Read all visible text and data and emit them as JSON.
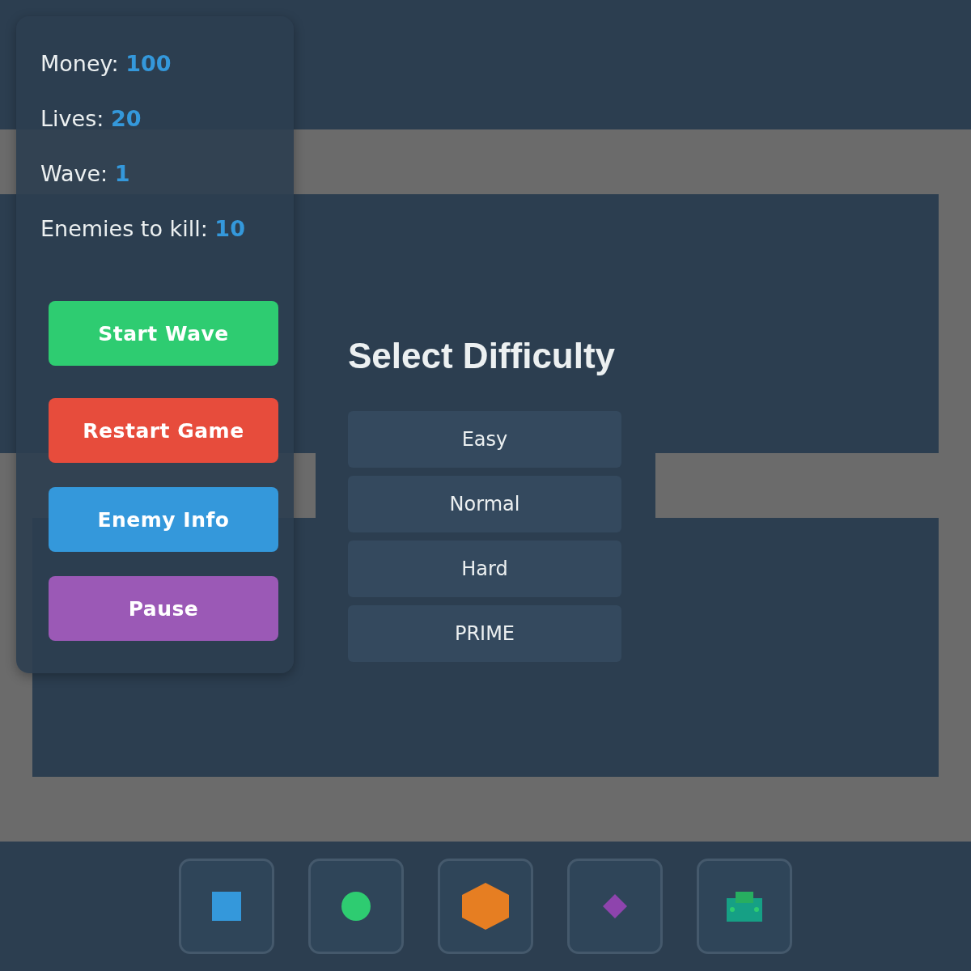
{
  "stats": [
    "Money: **100**",
    "Lives: **20**",
    "Wave: **1**",
    "Enemies to kill: **10**"
  ],
  "controls": [
    {
      "label": "Start Wave",
      "color": "#2ecc71"
    },
    {
      "label": "Restart Game",
      "color": "#e74c3c"
    },
    {
      "label": "Enemy Info",
      "color": "#3498db"
    },
    {
      "label": "Pause",
      "color": "#9b59b6"
    }
  ],
  "dialog": {
    "title": "Select Difficulty",
    "options": [
      "Easy",
      "Normal",
      "Hard",
      "PRIME"
    ]
  },
  "towers": [
    {
      "kind": "square",
      "color": "#3498db"
    },
    {
      "kind": "circle",
      "color": "#2ecc71"
    },
    {
      "kind": "hexagon",
      "color": "#e67e22"
    },
    {
      "kind": "diamond",
      "color": "#8e44ad"
    },
    {
      "kind": "tank",
      "color": "#16a085"
    }
  ]
}
